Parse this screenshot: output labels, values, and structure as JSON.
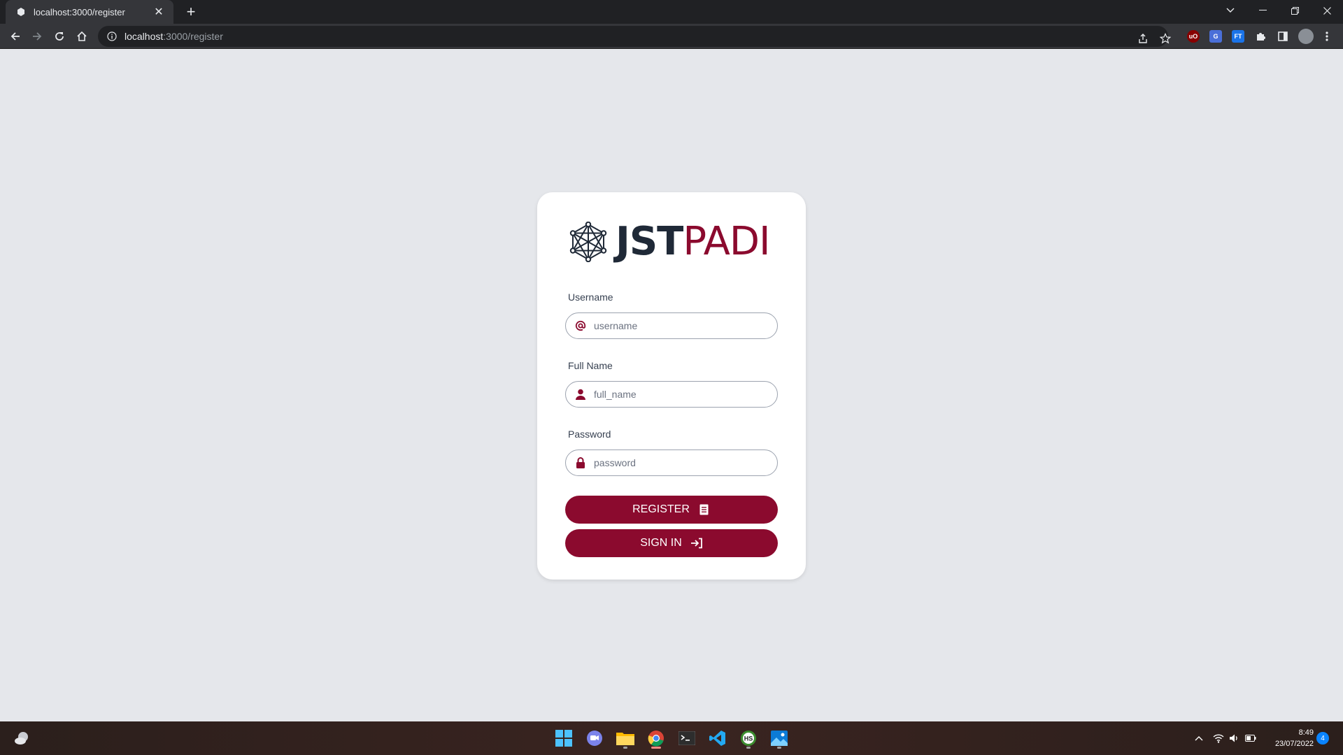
{
  "browser": {
    "tab_title": "localhost:3000/register",
    "new_tab_symbol": "+",
    "url_host": "localhost",
    "url_path": ":3000/register",
    "extensions": [
      "ublock-origin-icon",
      "google-translate-icon",
      "extension-icon-blue",
      "puzzle-extensions-icon",
      "sidepanel-icon",
      "profile-avatar"
    ]
  },
  "logo": {
    "part1": "JST",
    "part2": "PADI"
  },
  "form": {
    "username": {
      "label": "Username",
      "placeholder": "username",
      "icon": "at-icon"
    },
    "full_name": {
      "label": "Full Name",
      "placeholder": "full_name",
      "icon": "user-icon"
    },
    "password": {
      "label": "Password",
      "placeholder": "password",
      "icon": "lock-icon"
    },
    "register_label": "REGISTER",
    "signin_label": "SIGN IN"
  },
  "taskbar": {
    "apps": [
      "windows-start-icon",
      "teams-chat-icon",
      "file-explorer-icon",
      "chrome-icon",
      "terminal-icon",
      "vscode-icon",
      "hs-app-icon",
      "photos-icon"
    ],
    "time": "8:49",
    "date": "23/07/2022",
    "notifications": "4"
  },
  "colors": {
    "brand": "#8b0a2e",
    "dark": "#1f2937",
    "page_bg": "#e5e7eb"
  }
}
